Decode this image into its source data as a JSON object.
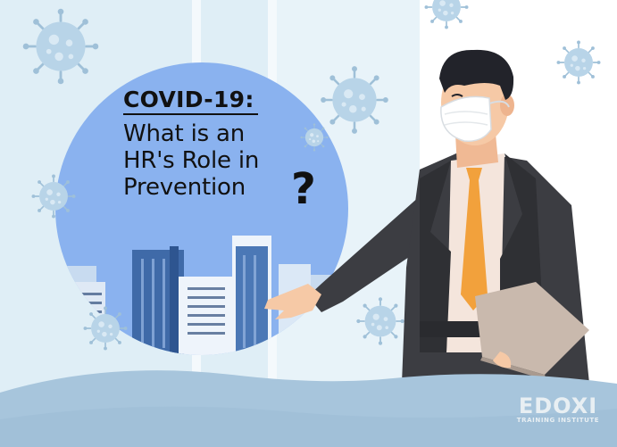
{
  "headline": {
    "line1": "COVID-19:",
    "line2": "What is an",
    "line3": "HR's Role in",
    "line4": "Prevention",
    "question_mark": "?"
  },
  "logo": {
    "main": "EDOXI",
    "tagline": "TRAINING INSTITUTE"
  },
  "colors": {
    "circle": "#8ab2ef",
    "window": "#dfeef6",
    "floor": "#a7c5dc",
    "suit": "#3c3d42",
    "tie": "#f2a13c",
    "mask": "#ffffff",
    "virus": "#a9cbe3"
  },
  "icons": [
    "virus-icon",
    "person-illustration",
    "building-icon",
    "laptop-icon",
    "mask-icon"
  ]
}
